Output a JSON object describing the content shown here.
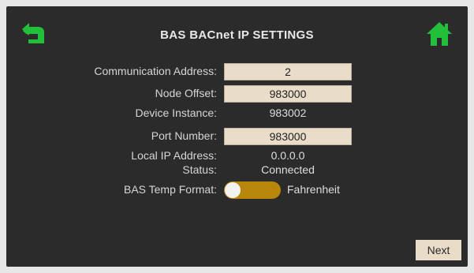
{
  "header": {
    "title": "BAS BACnet IP  SETTINGS",
    "back_icon": "back-arrow-icon",
    "home_icon": "home-icon",
    "accent_color": "#22c03a"
  },
  "settings": {
    "communication_address": {
      "label": "Communication Address:",
      "value": "2"
    },
    "node_offset": {
      "label": "Node Offset:",
      "value": "983000"
    },
    "device_instance": {
      "label": "Device Instance:",
      "value": "983002"
    },
    "port_number": {
      "label": "Port Number:",
      "value": "983000"
    },
    "local_ip": {
      "label": "Local IP Address:",
      "value": "0.0.0.0"
    },
    "status": {
      "label": "Status:",
      "value": "Connected"
    },
    "temp_format": {
      "label": "BAS Temp Format:",
      "value": "Fahrenheit",
      "toggle_color": "#b8860b"
    }
  },
  "footer": {
    "next_label": "Next"
  }
}
